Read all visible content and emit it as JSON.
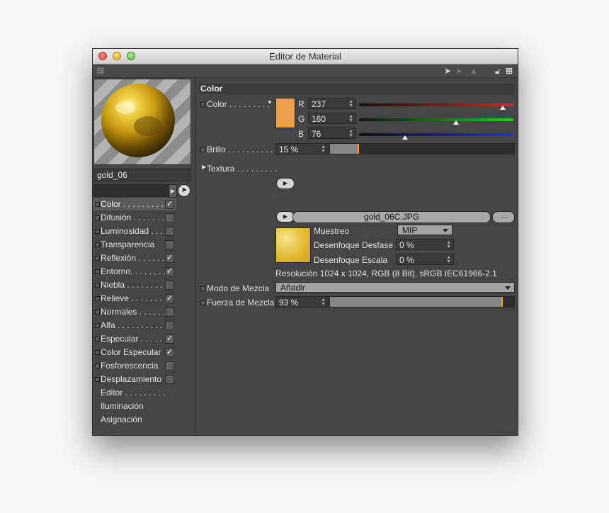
{
  "window": {
    "title": "Editor de Material"
  },
  "material": {
    "name": "gold_06"
  },
  "channels": [
    {
      "label": "Color . . . . . . . . .",
      "checked": "✓",
      "active": true
    },
    {
      "label": "Difusión . . . . . . .",
      "checked": ""
    },
    {
      "label": "Luminosidad . . .",
      "checked": ""
    },
    {
      "label": "Transparencia",
      "checked": ""
    },
    {
      "label": "Reflexión . . . . . .",
      "checked": "✓"
    },
    {
      "label": "Entorno. . . . . . . .",
      "checked": "✓"
    },
    {
      "label": "Niebla . . . . . . . . .",
      "checked": ""
    },
    {
      "label": "Relieve . . . . . . . .",
      "checked": "✓"
    },
    {
      "label": "Normales . . . . . .",
      "checked": ""
    },
    {
      "label": "Alfa . . . . . . . . . . .",
      "checked": ""
    },
    {
      "label": "Especular . . . . . .",
      "checked": "✓"
    },
    {
      "label": "Color Especular",
      "checked": "✓"
    },
    {
      "label": "Fosforescencia",
      "checked": ""
    },
    {
      "label": "Desplazamiento",
      "checked": ""
    }
  ],
  "extras": [
    {
      "label": "Editor . . . . . . . . ."
    },
    {
      "label": "Iluminación"
    },
    {
      "label": "Asignación"
    }
  ],
  "color_section": {
    "header": "Color",
    "color_label": "Color . . . . . . . . .",
    "swatch_color": "#ED A04C",
    "r_label": "R",
    "r_value": "237",
    "r_fraction": 0.929,
    "g_label": "G",
    "g_value": "160",
    "g_fraction": 0.627,
    "b_label": "B",
    "b_value": "76",
    "b_fraction": 0.298,
    "brillo_label": "Brillo . . . . . . . . . . .",
    "brillo_value": "15 %",
    "brillo_fraction": 0.15,
    "textura_label": "Textura . . . . . . . . .",
    "texture_file": "gold_06C.JPG",
    "more_button": "...",
    "muestreo_label": "Muestreo",
    "muestreo_value": "MIP",
    "desfase_label": "Desenfoque Desfase",
    "desfase_value": "0 %",
    "escala_label": "Desenfoque Escala",
    "escala_value": "0 %",
    "resolution": "Resolución 1024 x 1024, RGB (8 Bit), sRGB IEC61966-2.1",
    "modo_label": "Modo de Mezcla",
    "modo_value": "Añadir",
    "fuerza_label": "Fuerza de Mezcla",
    "fuerza_value": "93 %",
    "fuerza_fraction": 0.93
  }
}
